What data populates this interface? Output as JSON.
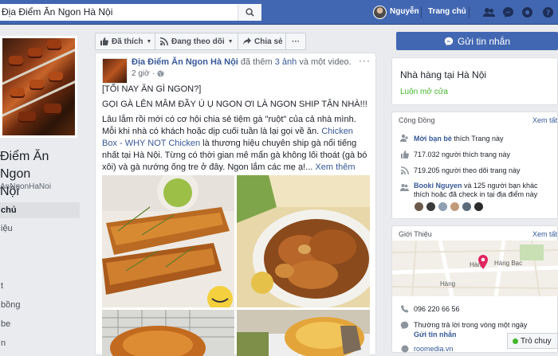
{
  "topbar": {
    "search_value": "Địa Điểm Ăn Ngon Hà Nội",
    "user_name": "Nguyễn",
    "home_label": "Trang chủ",
    "brand_color": "#4267b2"
  },
  "page": {
    "name_line1": "Điểm Ăn Ngon",
    "name_line2": "Nội",
    "handle": "AnNgonHaNoi",
    "nav": [
      {
        "label": "chủ",
        "active": true
      },
      {
        "label": "iệu"
      },
      {
        "label": "t"
      },
      {
        "label": "bồng"
      },
      {
        "label": "be"
      },
      {
        "label": "n"
      }
    ]
  },
  "actions": {
    "like_label": "Đã thích",
    "follow_label": "Đang theo dõi",
    "share_label": "Chia sẻ",
    "more_label": "···",
    "message_label": "Gửi tin nhắn"
  },
  "post": {
    "author": "Địa Điểm Ăn Ngon Hà Nội",
    "action_text": "đã thêm",
    "action_link": "3 ảnh",
    "action_tail": "và một video.",
    "time": "2 giờ",
    "line1": "[TỐI NAY ĂN GÌ NGON?]",
    "line2": "GỌI GÀ LÊN MÂM ĐẦY Ú Ụ NGON ƠI LÀ NGON SHIP TẬN NHÀ!!!",
    "body_a": "Lâu lắm rồi mới có cơ hội chia sẻ tiệm gà \"ruột\" của cả nhà mình. Mỗi khi nhà có khách hoặc dịp cuối tuần là lại gọi về ăn.",
    "body_link": "Chicken Box - WHY NOT Chicken",
    "body_b": "là thương hiệu chuyên ship gà nổi tiếng nhất tại Hà Nội. Từng có thời gian mê mẩn gà không lối thoát (gà bó xôi) và gà nướng ống tre ở đây. Ngon lắm các mẹ ạ!...",
    "see_more": "Xem thêm"
  },
  "sidebar": {
    "category": "Nhà hàng tại Hà Nội",
    "open_status": "Luôn mở cửa",
    "community_title": "Cộng Đồng",
    "see_all": "Xem tất",
    "invite_link": "Mời bạn bè",
    "invite_text": "thích Trang này",
    "likes": "717.032 người thích trang này",
    "follows": "719.205 người theo dõi trang này",
    "friend_name": "Booki Nguyen",
    "friend_text": "và 125 người bạn khác thích hoặc đã check in tại địa điểm này",
    "about_title": "Giới Thiệu",
    "about_see_all": "Xem tất",
    "phone": "096 220 66 56",
    "response": "Thường trả lời trong vòng một ngày",
    "send_message": "Gửi tin nhắn",
    "site": "roomedia.vn",
    "map_label1": "Hàng",
    "map_label2": "Hàng Bạc",
    "map_label3": "Hàng"
  },
  "chat": {
    "label": "Trò chuy",
    "online_color": "#42b72a"
  }
}
